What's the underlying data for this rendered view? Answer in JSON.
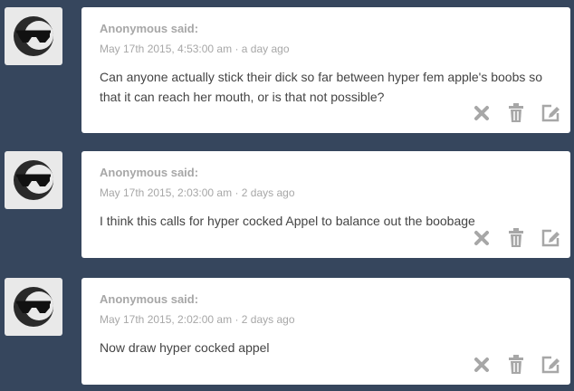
{
  "posts": [
    {
      "author": "Anonymous said:",
      "date": "May 17th 2015, 4:53:00 am",
      "relative": "a day ago",
      "text": "Can anyone actually stick their dick so far between hyper fem apple's boobs so that it can reach her mouth, or is that not possible?",
      "avatar_icon": "sunglasses-face-icon",
      "actions": [
        "delete-x-icon",
        "trash-icon",
        "edit-icon"
      ]
    },
    {
      "author": "Anonymous said:",
      "date": "May 17th 2015, 2:03:00 am",
      "relative": "2 days ago",
      "text": "I think this calls for hyper cocked Appel to balance out the boobage",
      "avatar_icon": "sunglasses-face-icon",
      "actions": [
        "delete-x-icon",
        "trash-icon",
        "edit-icon"
      ]
    },
    {
      "author": "Anonymous said:",
      "date": "May 17th 2015, 2:02:00 am",
      "relative": "2 days ago",
      "text": "Now draw hyper cocked appel",
      "avatar_icon": "sunglasses-face-icon",
      "actions": [
        "delete-x-icon",
        "trash-icon",
        "edit-icon"
      ]
    }
  ],
  "colors": {
    "background": "#36465d",
    "card": "#ffffff",
    "meta_text": "#a7a7a7",
    "body_text": "#444444",
    "icon": "#a7a7a7"
  }
}
